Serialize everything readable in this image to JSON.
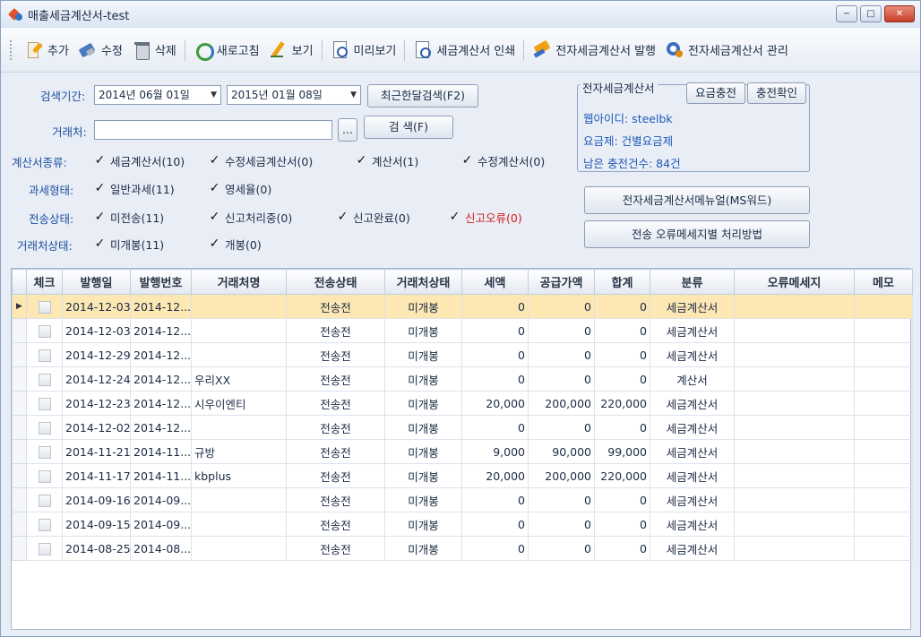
{
  "window": {
    "title": "매출세금계산서-test",
    "buttons": [
      "−",
      "□",
      "✕"
    ]
  },
  "toolbar": {
    "add": "추가",
    "edit": "수정",
    "delete": "삭제",
    "refresh": "새로고침",
    "view": "보기",
    "preview": "미리보기",
    "print": "세금계산서 인쇄",
    "issue": "전자세금계산서 발행",
    "manage": "전자세금계산서 관리"
  },
  "search": {
    "period_label": "검색기간:",
    "date_from": "2014년 06월 01일",
    "date_to": "2015년 01월 08일",
    "recent_month_button": "최근한달검색(F2)",
    "partner_label": "거래처:",
    "partner_value": "",
    "browse_button": "...",
    "search_button": "검 색(F)",
    "invoice_type_label": "계산서종류:",
    "invoice_types": [
      "세금계산서(10)",
      "수정세금계산서(0)",
      "계산서(1)",
      "수정계산서(0)"
    ],
    "tax_type_label": "과세형태:",
    "tax_types": [
      "일반과세(11)",
      "영세율(0)"
    ],
    "transmit_label": "전송상태:",
    "transmit_states": [
      "미전송(11)",
      "신고처리중(0)",
      "신고완료(0)",
      "신고오류(0)"
    ],
    "partner_status_label": "거래처상태:",
    "partner_states": [
      "미개봉(11)",
      "개봉(0)"
    ]
  },
  "einvoice": {
    "group_title": "전자세금계산서",
    "charge_button": "요금충전",
    "check_button": "충전확인",
    "web_id": "웹아이디: steelbk",
    "plan": "요금제: 건별요금제",
    "remaining": "남은 충전건수: 84건",
    "manual_button": "전자세금계산서메뉴얼(MS워드)",
    "error_guide_button": "전송 오류메세지별 처리방법"
  },
  "grid": {
    "columns": [
      "체크",
      "발행일",
      "발행번호",
      "거래처명",
      "전송상태",
      "거래처상태",
      "세액",
      "공급가액",
      "합계",
      "분류",
      "오류메세지",
      "메모"
    ],
    "rows": [
      [
        "2014-12-03",
        "2014-12...",
        "",
        "전송전",
        "미개봉",
        "0",
        "0",
        "0",
        "세금계산서",
        "",
        ""
      ],
      [
        "2014-12-03",
        "2014-12...",
        "",
        "전송전",
        "미개봉",
        "0",
        "0",
        "0",
        "세금계산서",
        "",
        ""
      ],
      [
        "2014-12-29",
        "2014-12...",
        "",
        "전송전",
        "미개봉",
        "0",
        "0",
        "0",
        "세금계산서",
        "",
        ""
      ],
      [
        "2014-12-24",
        "2014-12...",
        "우리XX",
        "전송전",
        "미개봉",
        "0",
        "0",
        "0",
        "계산서",
        "",
        ""
      ],
      [
        "2014-12-23",
        "2014-12...",
        "시우이엔티",
        "전송전",
        "미개봉",
        "20,000",
        "200,000",
        "220,000",
        "세금계산서",
        "",
        ""
      ],
      [
        "2014-12-02",
        "2014-12...",
        "",
        "전송전",
        "미개봉",
        "0",
        "0",
        "0",
        "세금계산서",
        "",
        ""
      ],
      [
        "2014-11-21",
        "2014-11...",
        "규방",
        "전송전",
        "미개봉",
        "9,000",
        "90,000",
        "99,000",
        "세금계산서",
        "",
        ""
      ],
      [
        "2014-11-17",
        "2014-11...",
        "kbplus",
        "전송전",
        "미개봉",
        "20,000",
        "200,000",
        "220,000",
        "세금계산서",
        "",
        ""
      ],
      [
        "2014-09-16",
        "2014-09...",
        "",
        "전송전",
        "미개봉",
        "0",
        "0",
        "0",
        "세금계산서",
        "",
        ""
      ],
      [
        "2014-09-15",
        "2014-09...",
        "",
        "전송전",
        "미개봉",
        "0",
        "0",
        "0",
        "세금계산서",
        "",
        ""
      ],
      [
        "2014-08-25",
        "2014-08...",
        "",
        "전송전",
        "미개봉",
        "0",
        "0",
        "0",
        "세금계산서",
        "",
        ""
      ]
    ],
    "selected_row": 0
  },
  "colors": {
    "label_blue": "#1d4fa0",
    "error_red": "#d41a1a",
    "selected_row": "#fde7b3"
  }
}
